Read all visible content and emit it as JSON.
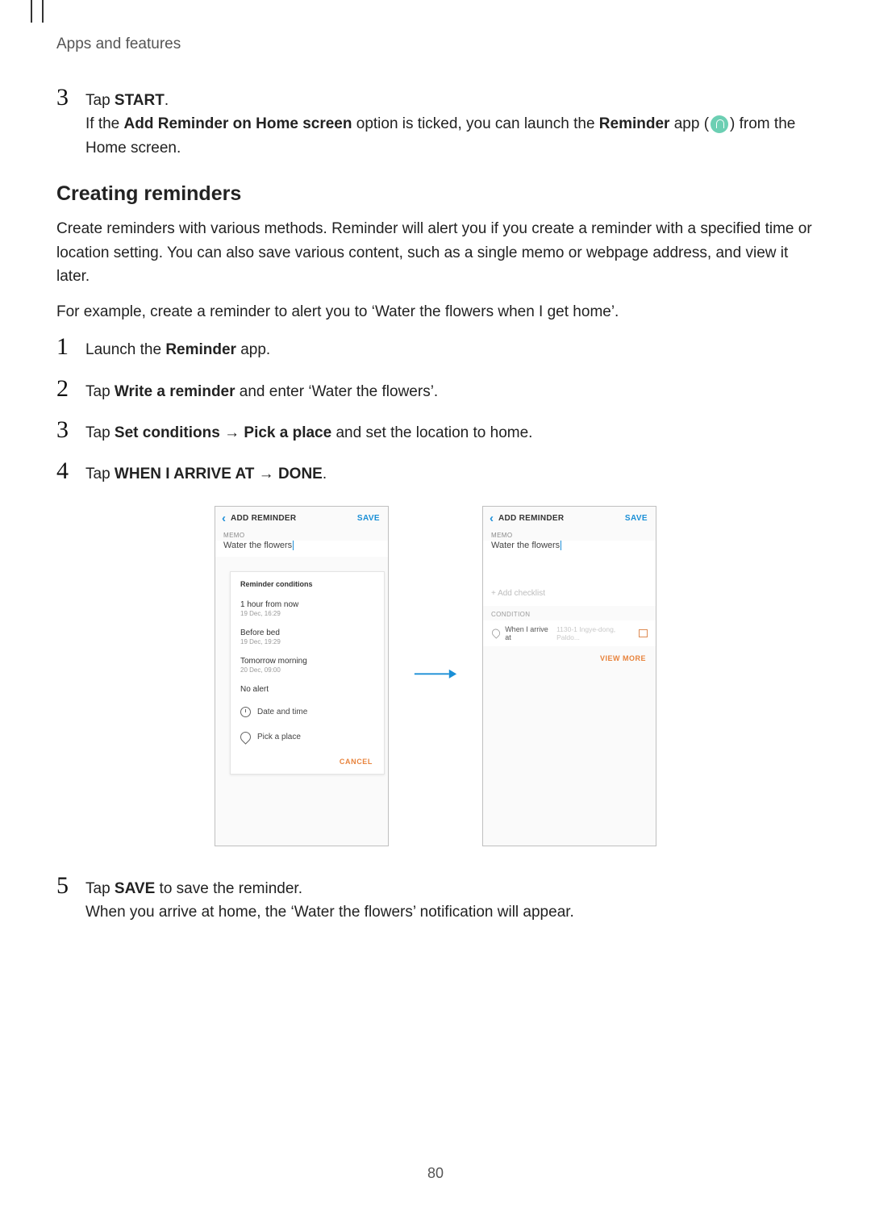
{
  "header": {
    "breadcrumb": "Apps and features"
  },
  "step_start": {
    "num": "3",
    "line1_pre": "Tap ",
    "line1_bold": "START",
    "line1_post": ".",
    "line2_pre": "If the ",
    "line2_b1": "Add Reminder on Home screen",
    "line2_mid": " option is ticked, you can launch the ",
    "line2_b2": "Reminder",
    "line2_post": " app (",
    "line2_after_icon": ") from the Home screen."
  },
  "section": {
    "title": "Creating reminders",
    "p1": "Create reminders with various methods. Reminder will alert you if you create a reminder with a specified time or location setting. You can also save various content, such as a single memo or webpage address, and view it later.",
    "p2": "For example, create a reminder to alert you to ‘Water the flowers when I get home’."
  },
  "steps": {
    "s1": {
      "num": "1",
      "pre": "Launch the ",
      "b": "Reminder",
      "post": " app."
    },
    "s2": {
      "num": "2",
      "pre": "Tap ",
      "b": "Write a reminder",
      "post": " and enter ‘Water the flowers’."
    },
    "s3": {
      "num": "3",
      "pre": "Tap ",
      "b1": "Set conditions",
      "arrow": " → ",
      "b2": "Pick a place",
      "post": " and set the location to home."
    },
    "s4": {
      "num": "4",
      "pre": "Tap ",
      "b": "WHEN I ARRIVE AT",
      "arrow": " → ",
      "b2": "DONE",
      "post": "."
    },
    "s5": {
      "num": "5",
      "pre": "Tap ",
      "b": "SAVE",
      "post": " to save the reminder.",
      "note": "When you arrive at home, the ‘Water the flowers’ notification will appear."
    }
  },
  "screen1": {
    "title": "ADD REMINDER",
    "save": "SAVE",
    "memo_label": "MEMO",
    "memo_value": "Water the flowers",
    "popup_title": "Reminder conditions",
    "items": [
      {
        "main": "1 hour from now",
        "sub": "19 Dec, 16:29"
      },
      {
        "main": "Before bed",
        "sub": "19 Dec, 19:29"
      },
      {
        "main": "Tomorrow morning",
        "sub": "20 Dec, 09:00"
      },
      {
        "main": "No alert",
        "sub": ""
      }
    ],
    "row_date": "Date and time",
    "row_place": "Pick a place",
    "cancel": "CANCEL"
  },
  "screen2": {
    "title": "ADD REMINDER",
    "save": "SAVE",
    "memo_label": "MEMO",
    "memo_value": "Water the flowers",
    "add_checklist": "+  Add checklist",
    "cond_label": "CONDITION",
    "cond_text": "When I arrive at",
    "cond_addr": "1130-1 Ingye-dong, Paldo...",
    "view_more": "VIEW MORE"
  },
  "page_number": "80"
}
